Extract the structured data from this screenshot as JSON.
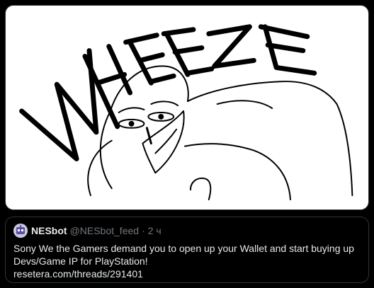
{
  "media": {
    "image_caption_text": "WHEEZE",
    "background_color": "#ffffff",
    "stroke_color": "#000000",
    "description_icon": "cartoon-laughing-figure"
  },
  "quote": {
    "display_name": "NESbot",
    "handle": "@NESbot_feed",
    "separator": "·",
    "time": "2 ч",
    "text_line_1": "Sony We the Gamers demand you to open up your Wallet and start buying up",
    "text_line_2": "Devs/Game IP for PlayStation!",
    "link_text": "resetera.com/threads/291401"
  },
  "colors": {
    "background": "#000000",
    "border": "#2f3336",
    "primary_text": "#e7e9ea",
    "secondary_text": "#71767b"
  }
}
